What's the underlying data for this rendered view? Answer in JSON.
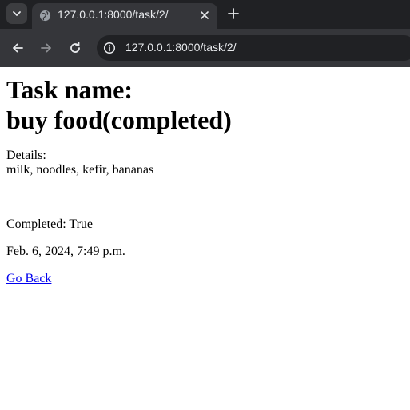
{
  "browser": {
    "tab": {
      "title": "127.0.0.1:8000/task/2/",
      "favicon": "globe-icon"
    },
    "address_bar": {
      "url": "127.0.0.1:8000/task/2/"
    },
    "colors": {
      "tabstrip": "#202124",
      "toolbar": "#35363a",
      "text": "#e8eaed"
    }
  },
  "page": {
    "heading_label": "Task name:",
    "task_title": "buy food(completed)",
    "details_label": "Details:",
    "details_text": "milk, noodles, kefir, bananas",
    "completed_text": "Completed: True",
    "date_text": "Feb. 6, 2024, 7:49 p.m.",
    "go_back_label": "Go Back",
    "link_color": "#0000ee"
  }
}
